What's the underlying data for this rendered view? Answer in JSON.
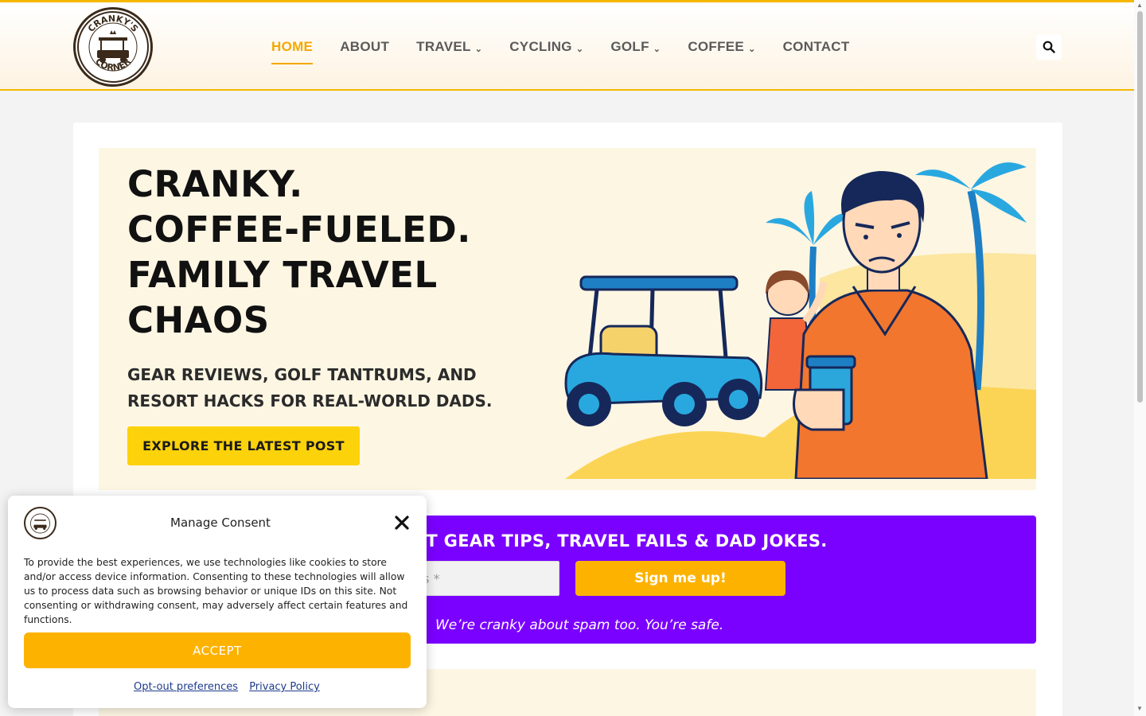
{
  "header": {
    "logo_text": "CRANKY'S CORNER",
    "nav": [
      {
        "label": "HOME",
        "active": true,
        "dropdown": false
      },
      {
        "label": "ABOUT",
        "active": false,
        "dropdown": false
      },
      {
        "label": "TRAVEL",
        "active": false,
        "dropdown": true
      },
      {
        "label": "CYCLING",
        "active": false,
        "dropdown": true
      },
      {
        "label": "GOLF",
        "active": false,
        "dropdown": true
      },
      {
        "label": "COFFEE",
        "active": false,
        "dropdown": true
      },
      {
        "label": "CONTACT",
        "active": false,
        "dropdown": false
      }
    ],
    "search_icon": "search-icon"
  },
  "hero": {
    "title_lines": [
      "CRANKY.",
      "COFFEE-FUELED.",
      "FAMILY TRAVEL",
      "CHAOS"
    ],
    "subtitle": "GEAR REVIEWS, GOLF TANTRUMS, AND RESORT HACKS FOR REAL-WORLD DADS.",
    "cta_label": "EXPLORE THE LATEST POST"
  },
  "signup": {
    "heading": "ST GEAR TIPS, TRAVEL FAILS & DAD JOKES.",
    "email_placeholder_visible": "ess *",
    "button_label": "Sign me up!",
    "note": "We’re cranky about spam too. You’re safe."
  },
  "consent": {
    "title": "Manage Consent",
    "body": "To provide the best experiences, we use technologies like cookies to store and/or access device information. Consenting to these technologies will allow us to process data such as browsing behavior or unique IDs on this site. Not consenting or withdrawing consent, may adversely affect certain features and functions.",
    "accept_label": "ACCEPT",
    "links": [
      "Opt-out preferences",
      "Privacy Policy"
    ]
  },
  "colors": {
    "accent": "#f5a800",
    "cta_yellow": "#fcd20a",
    "signup_purple": "#7a00ff",
    "signup_button": "#fdb200",
    "hero_bg": "#fdf6e3"
  }
}
